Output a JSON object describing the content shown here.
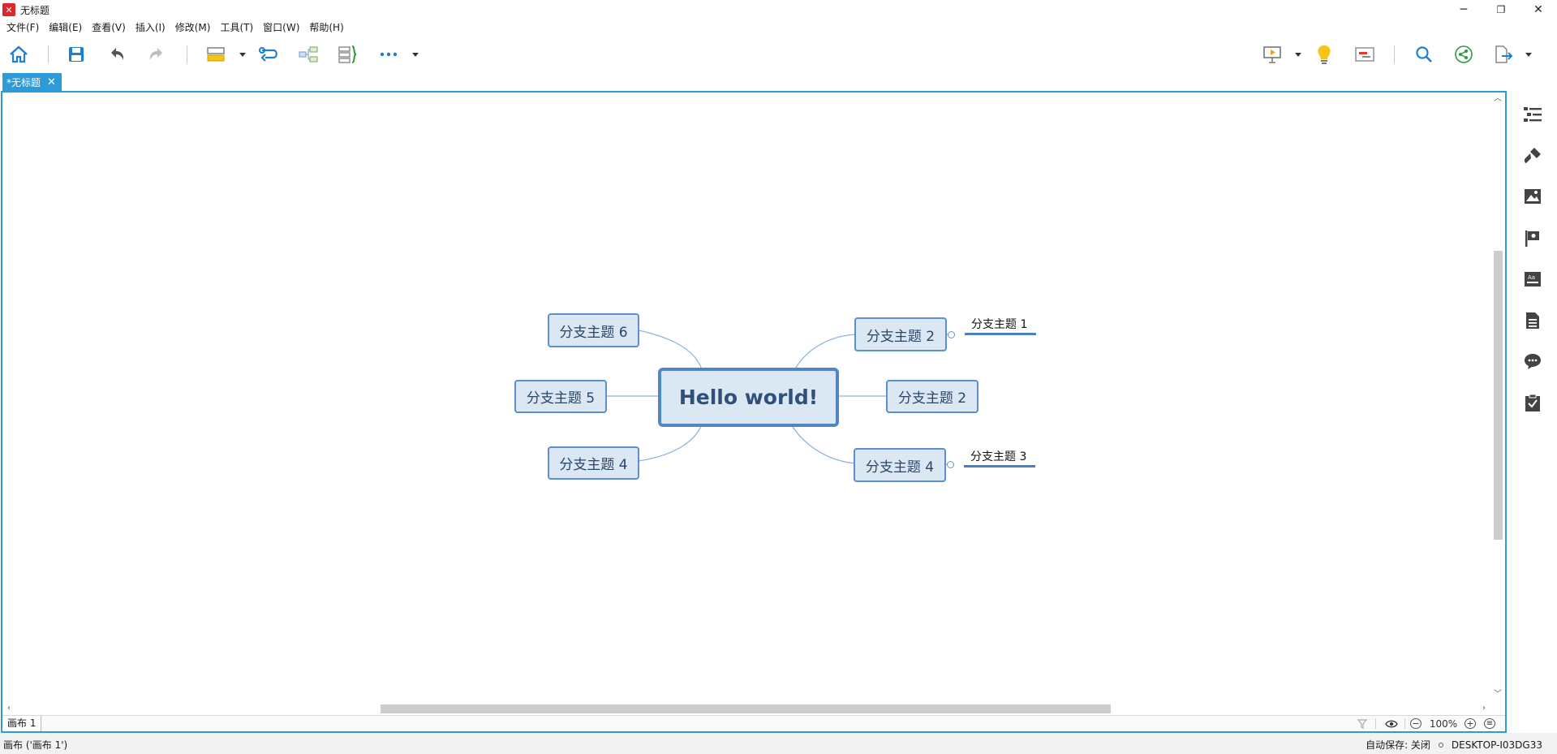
{
  "window": {
    "title": "无标题",
    "logo_glyph": "✕",
    "controls": {
      "minimize": "─",
      "restore": "❐",
      "close": "✕"
    }
  },
  "menu": [
    "文件(F)",
    "编辑(E)",
    "查看(V)",
    "插入(I)",
    "修改(M)",
    "工具(T)",
    "窗口(W)",
    "帮助(H)"
  ],
  "toolbar": {
    "left_icons": [
      "home-icon",
      "save-icon",
      "undo-icon",
      "redo-icon",
      "topic-style-icon",
      "relationship-icon",
      "structure-icon",
      "boundary-icon",
      "more-icon"
    ],
    "right_icons": [
      "presentation-icon",
      "idea-bulb-icon",
      "gantt-icon",
      "search-icon",
      "share-icon",
      "export-icon"
    ]
  },
  "tab": {
    "label": "*无标题",
    "close": "✕"
  },
  "mindmap": {
    "central": "Hello world!",
    "branches": {
      "left_top": "分支主题 6",
      "left_mid": "分支主题 5",
      "left_bottom": "分支主题 4",
      "right_top": "分支主题 2",
      "right_mid": "分支主题 2",
      "right_bottom": "分支主题 4"
    },
    "subtopics": {
      "upper": "分支主题 1",
      "lower": "分支主题 3"
    }
  },
  "sheetbar": {
    "sheet_label": "画布 1",
    "zoom_minus": "−",
    "zoom": "100%",
    "zoom_plus": "+",
    "menu": "≡"
  },
  "side_panel": [
    "outline-icon",
    "format-brush-icon",
    "image-icon",
    "flag-marker-icon",
    "text-style-icon",
    "notes-icon",
    "comment-icon",
    "task-icon"
  ],
  "statusbar": {
    "left": "画布 ('画布 1')",
    "autosave": "自动保存: 关闭",
    "device": "DESKTOP-I03DG33"
  },
  "colors": {
    "accent": "#2d9bd8",
    "node_fill": "#dce7f4",
    "node_border": "#5b8fd0",
    "line": "#8fb3dd"
  }
}
